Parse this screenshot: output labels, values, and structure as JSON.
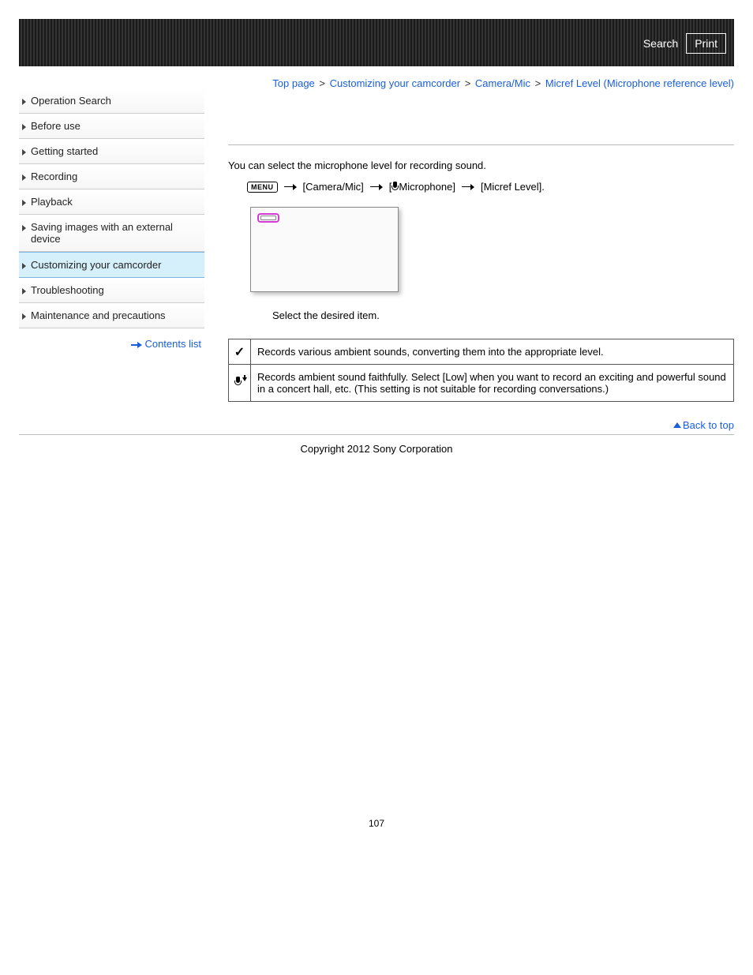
{
  "header": {
    "search": "Search",
    "print": "Print"
  },
  "breadcrumb": {
    "items": [
      "Top page",
      "Customizing your camcorder",
      "Camera/Mic",
      "Micref Level (Microphone reference level)"
    ],
    "sep": ">"
  },
  "sidebar": {
    "items": [
      "Operation Search",
      "Before use",
      "Getting started",
      "Recording",
      "Playback",
      "Saving images with an external device",
      "Customizing your camcorder",
      "Troubleshooting",
      "Maintenance and precautions"
    ],
    "active_index": 6,
    "contents_list": "Contents list"
  },
  "content": {
    "intro": "You can select the microphone level for recording sound.",
    "menu_label": "MENU",
    "path_step1": "[Camera/Mic]",
    "path_step2_prefix": "[",
    "path_step2_suffix": "Microphone]",
    "path_step3": "[Micref Level].",
    "select_line": "Select the desired item.",
    "options": [
      {
        "icon": "check",
        "desc": "Records various ambient sounds, converting them into the appropriate level."
      },
      {
        "icon": "mic-low",
        "desc": "Records ambient sound faithfully. Select [Low] when you want to record an exciting and powerful sound in a concert hall, etc. (This setting is not suitable for recording conversations.)"
      }
    ],
    "back_to_top": "Back to top"
  },
  "footer": {
    "copyright": "Copyright 2012 Sony Corporation",
    "page_number": "107"
  }
}
